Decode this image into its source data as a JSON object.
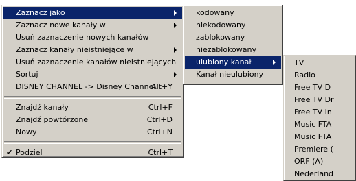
{
  "main_menu": {
    "items": [
      {
        "label": "Zaznacz jako",
        "shortcut": ""
      },
      {
        "label": "Zaznacz nowe kanały w",
        "shortcut": ""
      },
      {
        "label": "Usuń zaznaczenie nowych kanałów",
        "shortcut": ""
      },
      {
        "label": "Zaznacz kanały nieistniejące w",
        "shortcut": ""
      },
      {
        "label": "Usuń zaznaczenie kanałów nieistniejących",
        "shortcut": ""
      },
      {
        "label": "Sortuj",
        "shortcut": ""
      },
      {
        "label": "DISNEY CHANNEL -> Disney Channel",
        "shortcut": "Alt+Y"
      },
      {
        "label": "Znajdź kanały",
        "shortcut": "Ctrl+F"
      },
      {
        "label": "Znajdź powtórzone",
        "shortcut": "Ctrl+D"
      },
      {
        "label": "Nowy",
        "shortcut": "Ctrl+N"
      },
      {
        "label": "Podziel",
        "shortcut": "Ctrl+T"
      }
    ]
  },
  "submenu_mark_as": {
    "items": [
      {
        "label": "kodowany"
      },
      {
        "label": "niekodowany"
      },
      {
        "label": "zablokowany"
      },
      {
        "label": "niezablokowany"
      },
      {
        "label": "ulubiony kanał"
      },
      {
        "label": "Kanał nieulubiony"
      }
    ]
  },
  "submenu_favorites": {
    "items": [
      {
        "label": "TV"
      },
      {
        "label": "Radio"
      },
      {
        "label": "Free TV D"
      },
      {
        "label": "Free TV Dr"
      },
      {
        "label": "Free TV In"
      },
      {
        "label": "Music FTA"
      },
      {
        "label": "Music FTA"
      },
      {
        "label": "Premiere ("
      },
      {
        "label": "ORF (A)"
      },
      {
        "label": "Nederland"
      }
    ]
  },
  "colors": {
    "menu_bg": "#d4d0c8",
    "highlight_bg": "#0a246a",
    "highlight_text": "#ffffff"
  }
}
